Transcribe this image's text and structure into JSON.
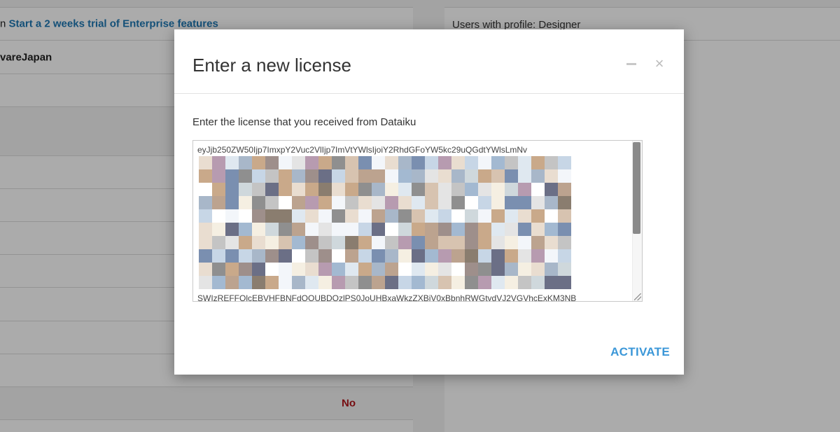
{
  "background": {
    "trial_prefix": "n",
    "trial_link": "Start a 2 weeks trial of Enterprise features",
    "company": "vareJapan",
    "no_value": "No",
    "right_label": "Users with profile: Designer"
  },
  "modal": {
    "title": "Enter a new license",
    "minimize_icon": "minimize-icon",
    "close_icon": "close-icon",
    "close_glyph": "×",
    "instruction": "Enter the license that you received from Dataiku",
    "license_first_line": "eyJjb250ZW50Ijp7ImxpY2Vuc2VlIjp7ImVtYWlsIjoiY2RhdGFoYW5kc29uQGdtYWlsLmNv",
    "license_last_line": "SWIzREFFQlcEBVHFBNFdOOUBDOzlPS0JoUHBxaWkzZXBjV0xBbnhRWGtvdVJ2VGVhcExKM3NB",
    "activate_label": "ACTIVATE"
  },
  "colors": {
    "accent": "#3b97d8",
    "link": "#1f78b4",
    "no_red": "#b0141a"
  }
}
